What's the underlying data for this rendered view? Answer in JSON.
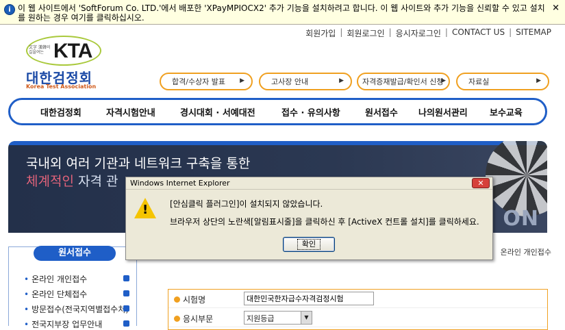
{
  "infobar": {
    "icon": "shield-info-icon",
    "message": "이 웹 사이트에서 'SoftForum Co. LTD.'에서 배포한 'XPayMPIOCX2' 추가 기능을 설치하려고 합니다. 이 웹 사이트와 추가 기능을 신뢰할 수 있고 설치를 원하는 경우 여기를 클릭하십시오.",
    "close": "×"
  },
  "toplinks": [
    "회원가입",
    "회원로그인",
    "응시자로그인",
    "CONTACT US",
    "SITEMAP"
  ],
  "logo": {
    "mark": "KTA",
    "small_text": "文字 漢韓의 길을여는",
    "korean": "대한검정회",
    "english": "Korea Test Association"
  },
  "pills": [
    "합격/수상자 발표",
    "고사장 안내",
    "자격증재발급/확인서 신청",
    "자료실"
  ],
  "mainnav": [
    "대한검정회",
    "자격시험안내",
    "경시대회 · 서예대전",
    "접수 · 유의사항",
    "원서접수",
    "나의원서관리",
    "보수교육"
  ],
  "banner": {
    "line1": "국내외 여러 기관과 네트워크 구축을 통한",
    "line2_highlight": "체계적인",
    "line2_rest": " 자격 관",
    "tail": "ON"
  },
  "leftmenu": {
    "title": "원서접수",
    "items": [
      "온라인 개인접수",
      "온라인 단체접수",
      "방문접수(전국지역별접수처)",
      "전국지부장 업무안내"
    ]
  },
  "breadcrumb": "온라인 개인접수",
  "form": {
    "exam_label": "시험명",
    "exam_value": "대한민국한자급수자격검정시험",
    "section_label": "응시부문",
    "section_value": "지원등급"
  },
  "dialog": {
    "title": "Windows Internet Explorer",
    "message1": "[안심클릭 플러그인]이 설치되지 않았습니다.",
    "message2": "브라우저 상단의 노란색[알림표시줄]을 클릭하신 후 [ActiveX 컨트롤 설치]를 클릭하세요.",
    "ok": "확인",
    "close": "✕"
  }
}
